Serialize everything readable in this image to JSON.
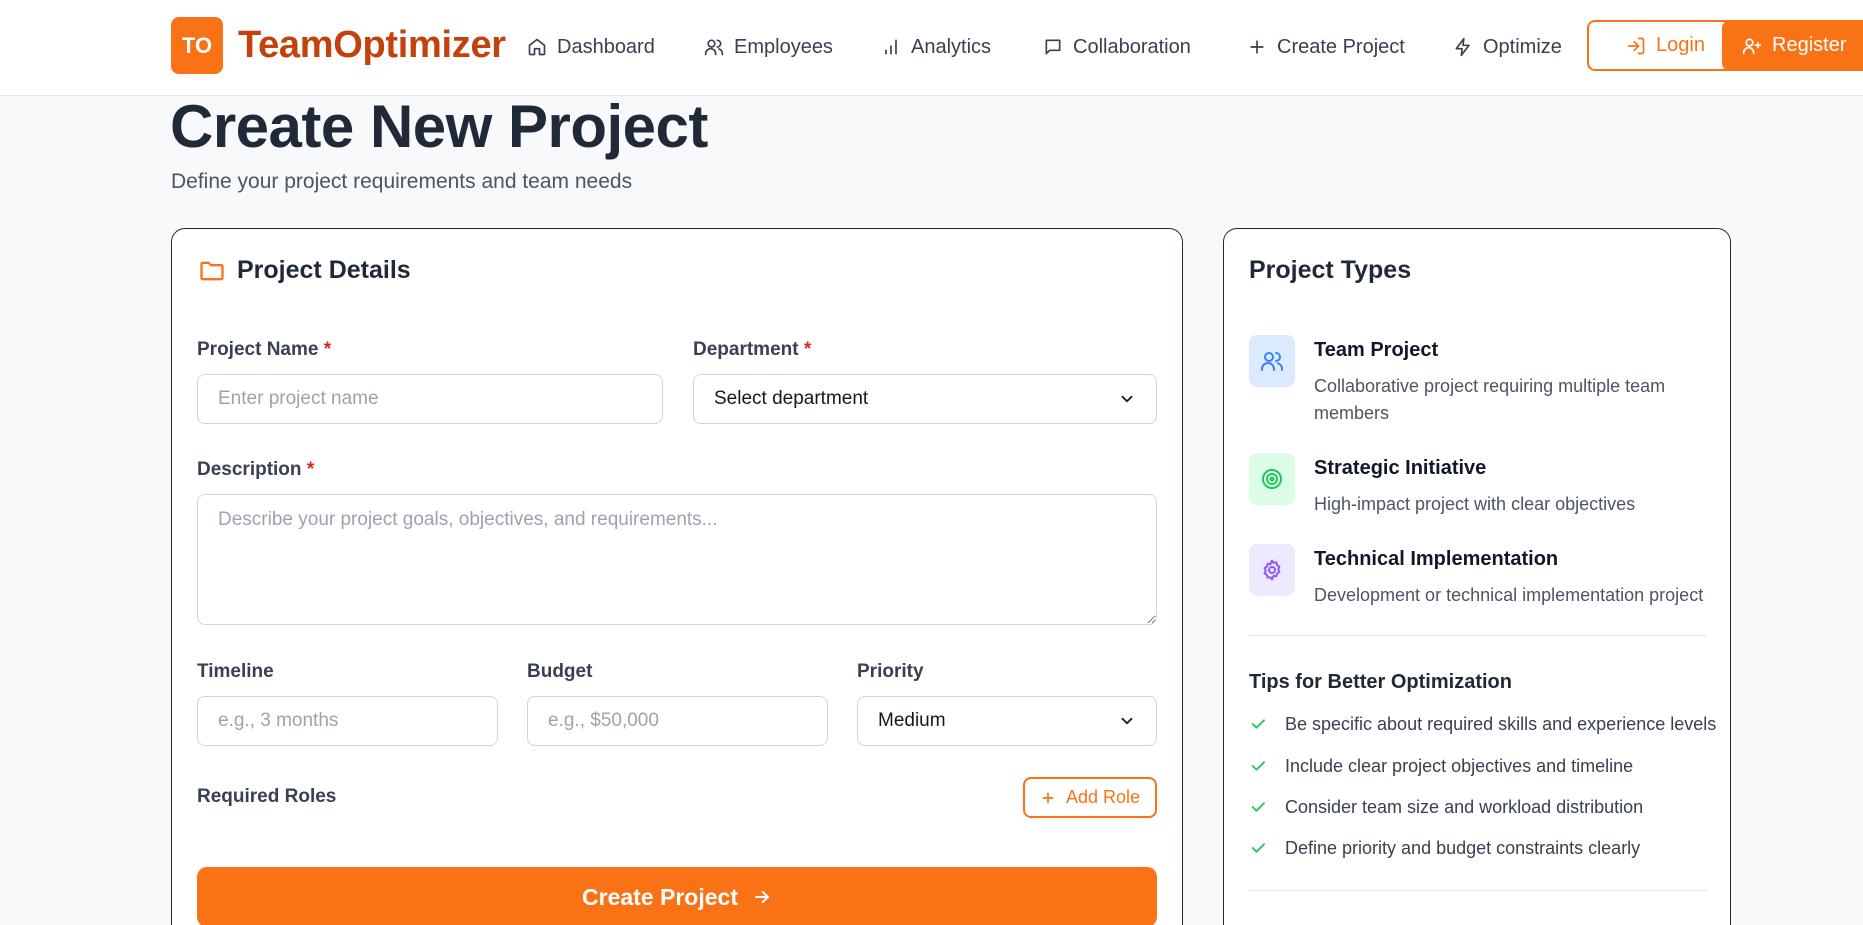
{
  "header": {
    "logo_initials": "TO",
    "brand": "TeamOptimizer",
    "nav": [
      {
        "label": "Dashboard",
        "icon": "home-icon"
      },
      {
        "label": "Employees",
        "icon": "users-icon"
      },
      {
        "label": "Analytics",
        "icon": "bar-chart-icon"
      },
      {
        "label": "Collaboration",
        "icon": "message-icon"
      },
      {
        "label": "Create Project",
        "icon": "plus-icon"
      },
      {
        "label": "Optimize",
        "icon": "zap-icon"
      }
    ],
    "login_label": "Login",
    "register_label": "Register"
  },
  "page": {
    "title": "Create New Project",
    "subtitle": "Define your project requirements and team needs"
  },
  "form": {
    "card_title": "Project Details",
    "project_name": {
      "label": "Project Name",
      "required_mark": "*",
      "placeholder": "Enter project name",
      "value": ""
    },
    "department": {
      "label": "Department",
      "required_mark": "*",
      "selected": "Select department"
    },
    "description": {
      "label": "Description",
      "required_mark": "*",
      "placeholder": "Describe your project goals, objectives, and requirements...",
      "value": ""
    },
    "timeline": {
      "label": "Timeline",
      "placeholder": "e.g., 3 months",
      "value": ""
    },
    "budget": {
      "label": "Budget",
      "placeholder": "e.g., $50,000",
      "value": ""
    },
    "priority": {
      "label": "Priority",
      "selected": "Medium"
    },
    "required_roles_label": "Required Roles",
    "add_role_label": "Add Role",
    "submit_label": "Create Project"
  },
  "sidebar": {
    "title": "Project Types",
    "types": [
      {
        "name": "Team Project",
        "description": "Collaborative project requiring multiple team members",
        "icon": "users-icon",
        "color": "#3b82f6",
        "bg": "#dbeafe"
      },
      {
        "name": "Strategic Initiative",
        "description": "High-impact project with clear objectives",
        "icon": "target-icon",
        "color": "#22c55e",
        "bg": "#dcfce7"
      },
      {
        "name": "Technical Implementation",
        "description": "Development or technical implementation project",
        "icon": "gear-icon",
        "color": "#8b5cf6",
        "bg": "#ede9fe"
      }
    ],
    "tips_title": "Tips for Better Optimization",
    "tips": [
      "Be specific about required skills and experience levels",
      "Include clear project objectives and timeline",
      "Consider team size and workload distribution",
      "Define priority and budget constraints clearly"
    ]
  },
  "colors": {
    "accent": "#f97316",
    "brand_text": "#c2410c",
    "required": "#dc2626",
    "check": "#22c55e"
  }
}
